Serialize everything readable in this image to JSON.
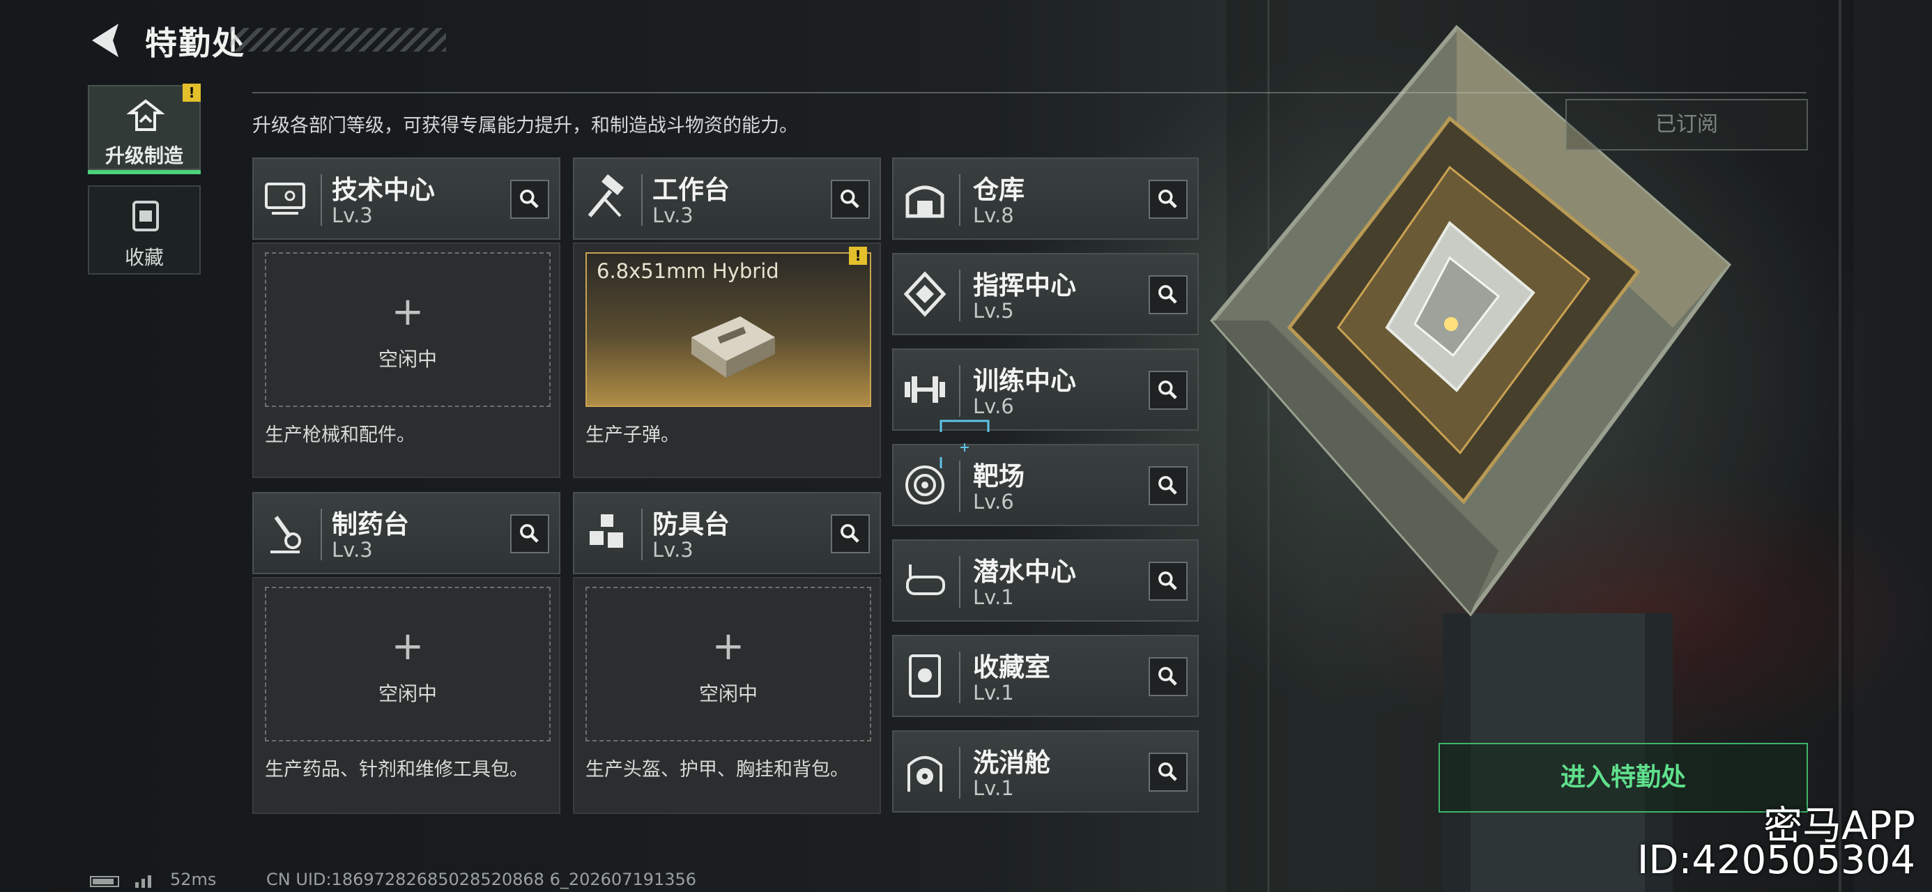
{
  "header": {
    "title": "特勤处"
  },
  "nav": {
    "tabs": [
      {
        "label": "升级制造",
        "alert": "!"
      },
      {
        "label": "收藏"
      }
    ]
  },
  "description": "升级各部门等级，可获得专属能力提升，和制造战斗物资的能力。",
  "subscribe_label": "已订阅",
  "enter_label": "进入特勤处",
  "idle_plus": "+",
  "workstations": [
    {
      "name": "技术中心",
      "level": "Lv.3",
      "status": "空闲中",
      "desc": "生产枪械和配件。"
    },
    {
      "name": "工作台",
      "level": "Lv.3",
      "product": "6.8x51mm Hybrid",
      "alert": "!",
      "desc": "生产子弹。"
    },
    {
      "name": "制药台",
      "level": "Lv.3",
      "status": "空闲中",
      "desc": "生产药品、针剂和维修工具包。"
    },
    {
      "name": "防具台",
      "level": "Lv.3",
      "status": "空闲中",
      "desc": "生产头盔、护甲、胸挂和背包。"
    }
  ],
  "facilities": [
    {
      "name": "仓库",
      "level": "Lv.8"
    },
    {
      "name": "指挥中心",
      "level": "Lv.5"
    },
    {
      "name": "训练中心",
      "level": "Lv.6"
    },
    {
      "name": "靶场",
      "level": "Lv.6"
    },
    {
      "name": "潜水中心",
      "level": "Lv.1"
    },
    {
      "name": "收藏室",
      "level": "Lv.1"
    },
    {
      "name": "洗消舱",
      "level": "Lv.1"
    }
  ],
  "status_bar": {
    "ping": "52ms",
    "uid": "CN UID:18697282685028520868 6_202607191356"
  },
  "watermark": {
    "app": "密马APP",
    "id": "ID:420505304"
  },
  "colors": {
    "accent_green": "#4bd37a",
    "alert_yellow": "#e3bf2b",
    "product_gold": "#caa253"
  },
  "icons": {
    "workstations": [
      "tech-center-icon",
      "workbench-hammer-icon",
      "pharmacy-microscope-icon",
      "armor-bench-icon"
    ],
    "facilities": [
      "warehouse-icon",
      "command-center-icon",
      "dumbbell-icon",
      "target-icon",
      "diving-goggles-icon",
      "collection-case-icon",
      "radiation-icon"
    ]
  }
}
